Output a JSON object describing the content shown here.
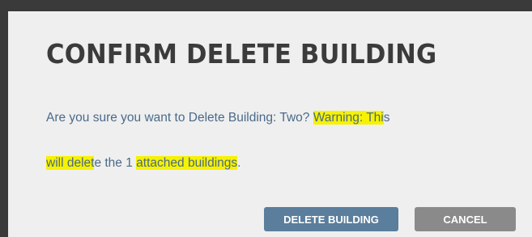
{
  "dialog": {
    "title": "CONFIRM DELETE BUILDING",
    "message": {
      "part1": "Are you sure you want to Delete Building: Two? ",
      "warning1": "Warning: Thi",
      "part2": "s ",
      "warning2": "will delet",
      "part3": "e the 1 ",
      "warning3": "attached buildings",
      "part4": "."
    },
    "buttons": {
      "delete_label": "DELETE BUILDING",
      "cancel_label": "CANCEL"
    }
  },
  "colors": {
    "title": "#3b3b3b",
    "message_text": "#4a6a8a",
    "highlight": "#f6f200",
    "delete_button": "#5a7e9c",
    "cancel_button": "#8a8a8a",
    "dialog_background": "#efefef"
  }
}
